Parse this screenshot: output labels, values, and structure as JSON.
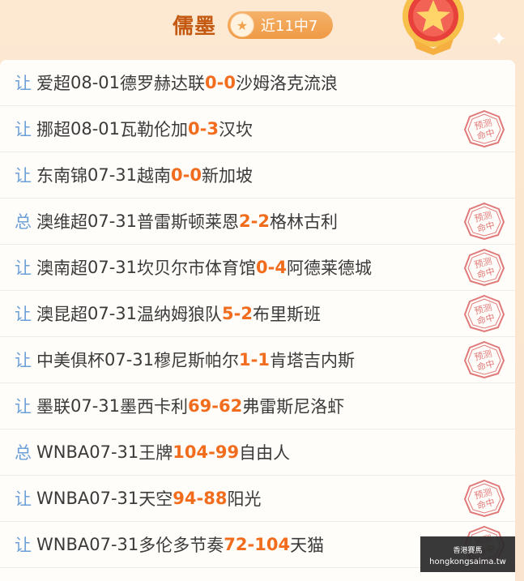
{
  "header": {
    "author": "儒墨",
    "record": "近11中7"
  },
  "colors": {
    "accent": "#f26c1d",
    "type_label": "#6b9fd8",
    "stamp": "#e07a7a"
  },
  "stamp_text": "预测命中",
  "matches": [
    {
      "type": "让",
      "league": "爱超",
      "date": "08-01",
      "home": "德罗赫达联",
      "home_score": "0",
      "away_score": "0",
      "away": "沙姆洛克流浪",
      "hit": false
    },
    {
      "type": "让",
      "league": "挪超",
      "date": "08-01",
      "home": "瓦勒伦加",
      "home_score": "0",
      "away_score": "3",
      "away": "汉坎",
      "hit": true
    },
    {
      "type": "让",
      "league": "东南锦",
      "date": "07-31",
      "home": "越南",
      "home_score": "0",
      "away_score": "0",
      "away": "新加坡",
      "hit": false
    },
    {
      "type": "总",
      "league": "澳维超",
      "date": "07-31",
      "home": "普雷斯顿莱恩",
      "home_score": "2",
      "away_score": "2",
      "away": "格林古利",
      "hit": true
    },
    {
      "type": "让",
      "league": "澳南超",
      "date": "07-31",
      "home": "坎贝尔市体育馆",
      "home_score": "0",
      "away_score": "4",
      "away": "阿德莱德城",
      "hit": true
    },
    {
      "type": "让",
      "league": "澳昆超",
      "date": "07-31",
      "home": "温纳姆狼队",
      "home_score": "5",
      "away_score": "2",
      "away": "布里斯班",
      "hit": true
    },
    {
      "type": "让",
      "league": "中美俱杯",
      "date": "07-31",
      "home": "穆尼斯帕尔",
      "home_score": "1",
      "away_score": "1",
      "away": "肯塔吉内斯",
      "hit": true
    },
    {
      "type": "让",
      "league": "墨联",
      "date": "07-31",
      "home": "墨西卡利",
      "home_score": "69",
      "away_score": "62",
      "away": "弗雷斯尼洛虾",
      "hit": false
    },
    {
      "type": "总",
      "league": "WNBA",
      "date": "07-31",
      "home": "王牌",
      "home_score": "104",
      "away_score": "99",
      "away": "自由人",
      "hit": false
    },
    {
      "type": "让",
      "league": "WNBA",
      "date": "07-31",
      "home": "天空",
      "home_score": "94",
      "away_score": "88",
      "away": "阳光",
      "hit": true
    },
    {
      "type": "让",
      "league": "WNBA",
      "date": "07-31",
      "home": "多伦多节奏",
      "home_score": "72",
      "away_score": "104",
      "away": "天猫",
      "hit": true
    }
  ],
  "watermark": {
    "line1": "香港賽馬",
    "line2": "hongkongsaima.tw"
  }
}
